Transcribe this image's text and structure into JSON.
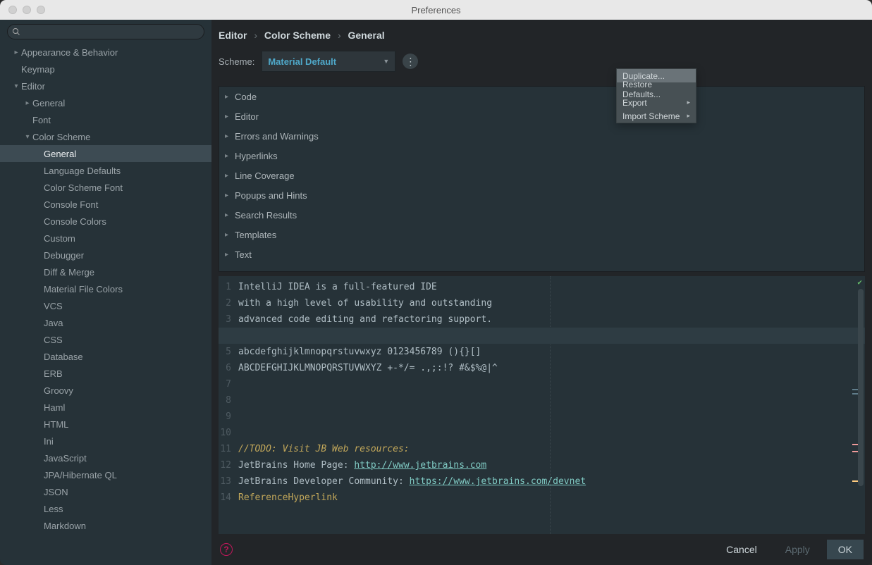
{
  "window_title": "Preferences",
  "search_placeholder": "",
  "sidebar": [
    {
      "label": "Appearance & Behavior",
      "indent": 0,
      "chev": "right"
    },
    {
      "label": "Keymap",
      "indent": 0,
      "chev": ""
    },
    {
      "label": "Editor",
      "indent": 0,
      "chev": "down"
    },
    {
      "label": "General",
      "indent": 1,
      "chev": "right"
    },
    {
      "label": "Font",
      "indent": 1,
      "chev": ""
    },
    {
      "label": "Color Scheme",
      "indent": 1,
      "chev": "down"
    },
    {
      "label": "General",
      "indent": 2,
      "chev": "",
      "selected": true
    },
    {
      "label": "Language Defaults",
      "indent": 2,
      "chev": ""
    },
    {
      "label": "Color Scheme Font",
      "indent": 2,
      "chev": ""
    },
    {
      "label": "Console Font",
      "indent": 2,
      "chev": ""
    },
    {
      "label": "Console Colors",
      "indent": 2,
      "chev": ""
    },
    {
      "label": "Custom",
      "indent": 2,
      "chev": ""
    },
    {
      "label": "Debugger",
      "indent": 2,
      "chev": ""
    },
    {
      "label": "Diff & Merge",
      "indent": 2,
      "chev": ""
    },
    {
      "label": "Material File Colors",
      "indent": 2,
      "chev": ""
    },
    {
      "label": "VCS",
      "indent": 2,
      "chev": ""
    },
    {
      "label": "Java",
      "indent": 2,
      "chev": ""
    },
    {
      "label": "CSS",
      "indent": 2,
      "chev": ""
    },
    {
      "label": "Database",
      "indent": 2,
      "chev": ""
    },
    {
      "label": "ERB",
      "indent": 2,
      "chev": ""
    },
    {
      "label": "Groovy",
      "indent": 2,
      "chev": ""
    },
    {
      "label": "Haml",
      "indent": 2,
      "chev": ""
    },
    {
      "label": "HTML",
      "indent": 2,
      "chev": ""
    },
    {
      "label": "Ini",
      "indent": 2,
      "chev": ""
    },
    {
      "label": "JavaScript",
      "indent": 2,
      "chev": ""
    },
    {
      "label": "JPA/Hibernate QL",
      "indent": 2,
      "chev": ""
    },
    {
      "label": "JSON",
      "indent": 2,
      "chev": ""
    },
    {
      "label": "Less",
      "indent": 2,
      "chev": ""
    },
    {
      "label": "Markdown",
      "indent": 2,
      "chev": ""
    }
  ],
  "breadcrumb": [
    "Editor",
    "Color Scheme",
    "General"
  ],
  "scheme_label": "Scheme:",
  "scheme_value": "Material Default",
  "popup": [
    {
      "label": "Duplicate...",
      "hover": true,
      "sub": false
    },
    {
      "label": "Restore Defaults...",
      "hover": false,
      "sub": false
    },
    {
      "label": "Export",
      "hover": false,
      "sub": true
    },
    {
      "label": "Import Scheme",
      "hover": false,
      "sub": true
    }
  ],
  "categories": [
    "Code",
    "Editor",
    "Errors and Warnings",
    "Hyperlinks",
    "Line Coverage",
    "Popups and Hints",
    "Search Results",
    "Templates",
    "Text"
  ],
  "code": [
    {
      "n": 1,
      "t": "IntelliJ IDEA is a full-featured IDE"
    },
    {
      "n": 2,
      "t": "with a high level of usability and outstanding"
    },
    {
      "n": 3,
      "t": "advanced code editing and refactoring support."
    },
    {
      "n": 4,
      "t": "",
      "hl": true
    },
    {
      "n": 5,
      "t": "abcdefghijklmnopqrstuvwxyz 0123456789 (){}[]"
    },
    {
      "n": 6,
      "t": "ABCDEFGHIJKLMNOPQRSTUVWXYZ +-*/= .,;:!? #&$%@|^"
    },
    {
      "n": 7,
      "t": ""
    },
    {
      "n": 8,
      "t": ""
    },
    {
      "n": 9,
      "t": ""
    },
    {
      "n": 10,
      "t": ""
    },
    {
      "n": 11,
      "todo": "//TODO: Visit JB Web resources:"
    },
    {
      "n": 12,
      "pre": "JetBrains Home Page: ",
      "link": "http://www.jetbrains.com"
    },
    {
      "n": 13,
      "pre": "JetBrains Developer Community: ",
      "link": "https://www.jetbrains.com/devnet"
    },
    {
      "n": 14,
      "ref": "ReferenceHyperlink"
    }
  ],
  "footer": {
    "cancel": "Cancel",
    "apply": "Apply",
    "ok": "OK"
  }
}
